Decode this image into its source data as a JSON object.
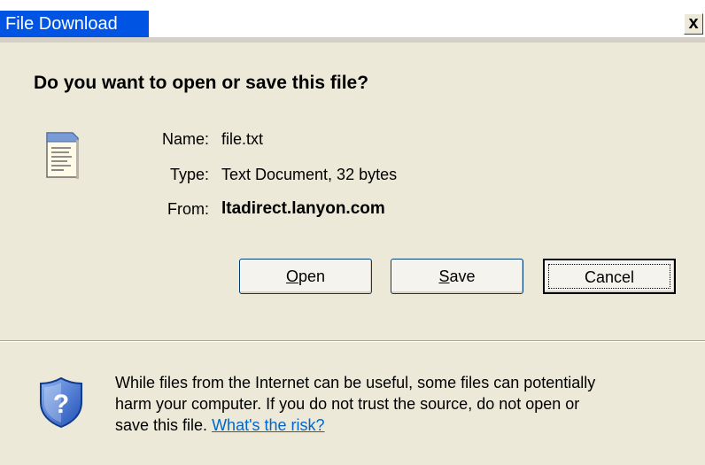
{
  "window": {
    "title": "File Download",
    "close_glyph": "x"
  },
  "prompt": {
    "question": "Do you want to open or save this file?"
  },
  "file": {
    "icon": "text-document-icon",
    "name_label": "Name:",
    "name_value": "file.txt",
    "type_label": "Type:",
    "type_value": "Text Document, 32 bytes",
    "from_label": "From:",
    "from_value": "ltadirect.lanyon.com"
  },
  "buttons": {
    "open": {
      "accel": "O",
      "rest": "pen"
    },
    "save": {
      "accel": "S",
      "rest": "ave"
    },
    "cancel": {
      "label": "Cancel"
    }
  },
  "warning": {
    "icon": "security-shield-question-icon",
    "line1": "While files from the Internet can be useful, some files can potentially",
    "line2": "harm your computer. If you do not trust the source, do not open or",
    "line3_prefix": "save this file.",
    "risk_link": "What's the risk?"
  },
  "colors": {
    "title_bar": "#0054e3",
    "dialog_bg": "#ece9d8",
    "link": "#0066cc"
  }
}
